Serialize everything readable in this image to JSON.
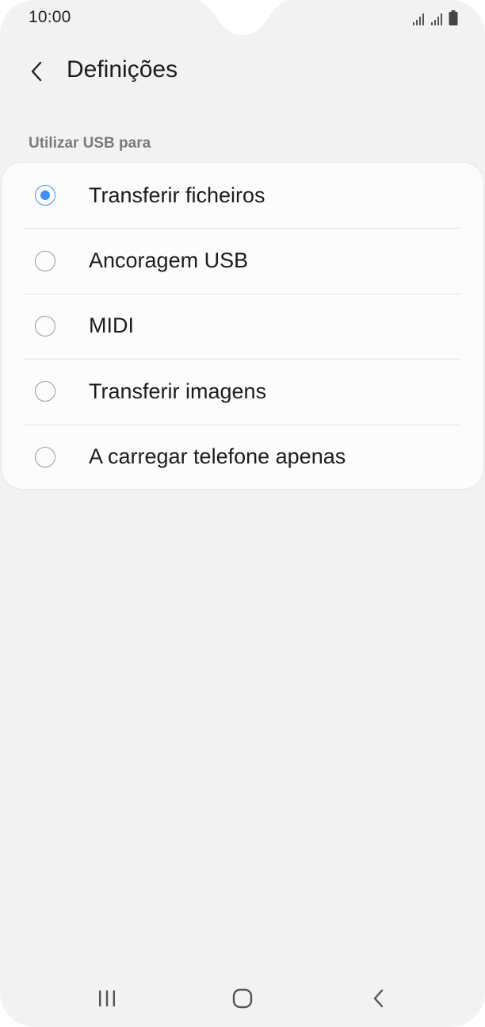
{
  "status_bar": {
    "time": "10:00",
    "icons": [
      "signal-icon",
      "signal-icon",
      "battery-icon"
    ]
  },
  "header": {
    "back_icon": "chevron-left-icon",
    "title": "Definições"
  },
  "usb_section": {
    "label": "Utilizar USB para",
    "options": [
      {
        "label": "Transferir ficheiros",
        "selected": true
      },
      {
        "label": "Ancoragem USB",
        "selected": false
      },
      {
        "label": "MIDI",
        "selected": false
      },
      {
        "label": "Transferir imagens",
        "selected": false
      },
      {
        "label": "A carregar telefone apenas",
        "selected": false
      }
    ]
  },
  "nav_bar": {
    "icons": [
      "recent-apps-icon",
      "home-icon",
      "back-icon"
    ]
  },
  "colors": {
    "accent": "#3e91f5",
    "background": "#f2f2f2",
    "card": "#fcfcfc"
  }
}
